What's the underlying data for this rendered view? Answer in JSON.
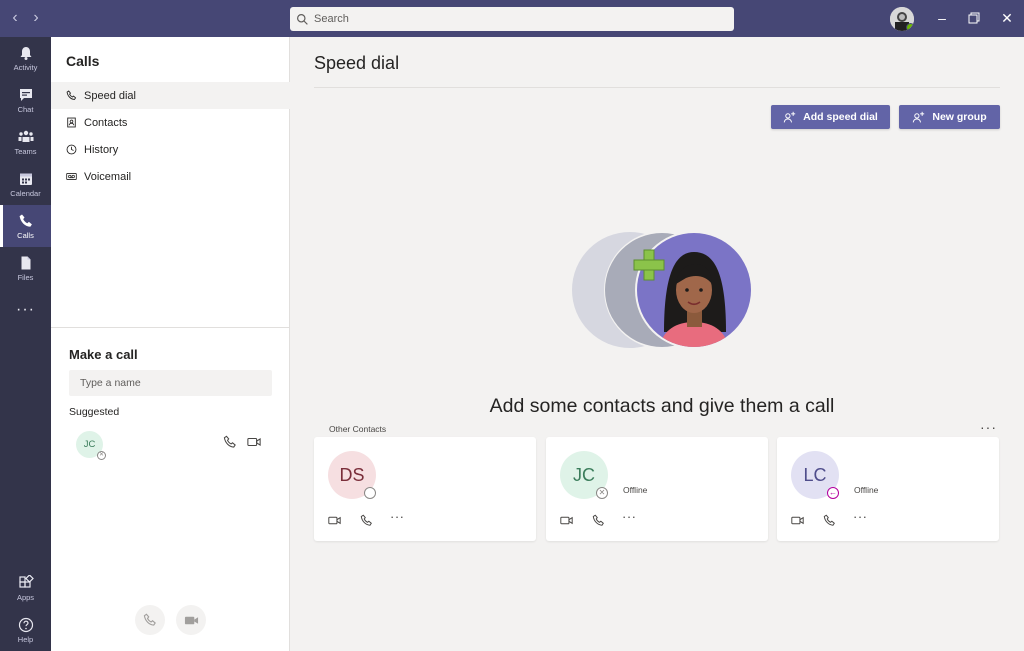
{
  "search": {
    "placeholder": "Search"
  },
  "appbar": {
    "items": [
      {
        "label": "Activity",
        "icon": "bell-icon"
      },
      {
        "label": "Chat",
        "icon": "chat-icon"
      },
      {
        "label": "Teams",
        "icon": "teams-icon"
      },
      {
        "label": "Calendar",
        "icon": "calendar-icon"
      },
      {
        "label": "Calls",
        "icon": "phone-icon",
        "active": true
      },
      {
        "label": "Files",
        "icon": "file-icon"
      }
    ],
    "more": "···",
    "bottom": [
      {
        "label": "Apps",
        "icon": "apps-icon"
      },
      {
        "label": "Help",
        "icon": "help-icon"
      }
    ]
  },
  "leftpanel": {
    "title": "Calls",
    "items": [
      {
        "label": "Speed dial",
        "icon": "phone-icon",
        "active": true
      },
      {
        "label": "Contacts",
        "icon": "contacts-icon"
      },
      {
        "label": "History",
        "icon": "clock-icon"
      },
      {
        "label": "Voicemail",
        "icon": "voicemail-icon"
      }
    ],
    "make_call": {
      "title": "Make a call",
      "input_placeholder": "Type a name",
      "suggested_label": "Suggested",
      "suggested": [
        {
          "initials": "JC"
        }
      ]
    }
  },
  "main": {
    "title": "Speed dial",
    "add_speed_dial": "Add speed dial",
    "new_group": "New group",
    "empty_heading": "Add some contacts and give them a call",
    "section_label": "Other Contacts",
    "section_more": "···",
    "contacts": [
      {
        "initials": "DS",
        "status": "",
        "avatar_bg": "#f6dfe1",
        "avatar_fg": "#7a2e3a"
      },
      {
        "initials": "JC",
        "status": "Offline",
        "avatar_bg": "#dff3e8",
        "avatar_fg": "#3b7d5b"
      },
      {
        "initials": "LC",
        "status": "Offline",
        "avatar_bg": "#e2e1f3",
        "avatar_fg": "#4f4d8b"
      }
    ],
    "card_more": "···"
  },
  "colors": {
    "brand": "#6264a7",
    "titlebar": "#464775",
    "appbar": "#33344a"
  }
}
